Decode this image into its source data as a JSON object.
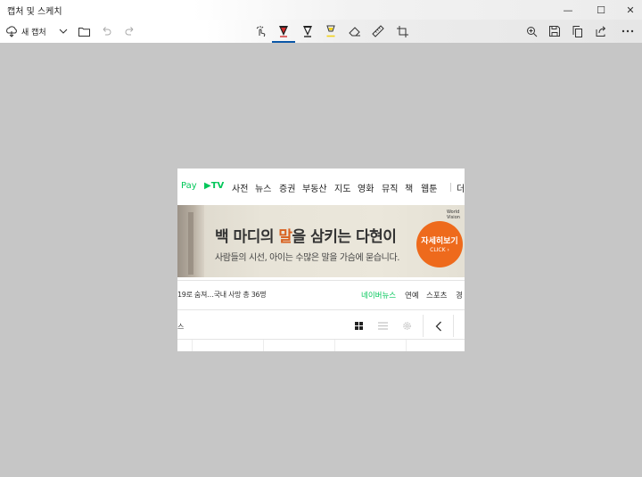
{
  "app": {
    "title": "캡처 및 스케치",
    "window_controls": {
      "minimize": "—",
      "maximize": "☐",
      "close": "✕"
    }
  },
  "toolbar": {
    "new_capture_label": "새 캡처",
    "tools": [
      "touch-writing",
      "ballpoint-pen",
      "pencil",
      "highlighter",
      "eraser",
      "ruler",
      "crop"
    ],
    "selected_tool": "ballpoint-pen",
    "pen_colors": {
      "ballpoint": "#d32b2b",
      "pencil": "#222222",
      "highlighter": "#f2d21b"
    },
    "accent": "#0b57a8"
  },
  "capture": {
    "nav": {
      "items": [
        "Pay",
        "▶TV",
        "사전",
        "뉴스",
        "증권",
        "부동산",
        "지도",
        "영화",
        "뮤직",
        "책",
        "웹툰",
        "더"
      ]
    },
    "banner": {
      "brand": "World Vision",
      "headline_part1": "백 마디의 ",
      "headline_highlight": "말",
      "headline_part2": "을 삼키는 다현이",
      "subline": "사람들의 시선, 아이는 수많은 말을 가슴에 묻습니다.",
      "cta_main": "자세히보기",
      "cta_sub": "CLICK ›"
    },
    "ticker": "19로 숨져…국내 사망 총 36명",
    "tabs": [
      "네이버뉴스",
      "연예",
      "스포츠",
      "경"
    ],
    "active_tab": "네이버뉴스",
    "section_label": "스",
    "colors": {
      "naver_green": "#03c75a",
      "cta_orange": "#ee6a1c",
      "highlight_orange": "#d8601f"
    }
  }
}
